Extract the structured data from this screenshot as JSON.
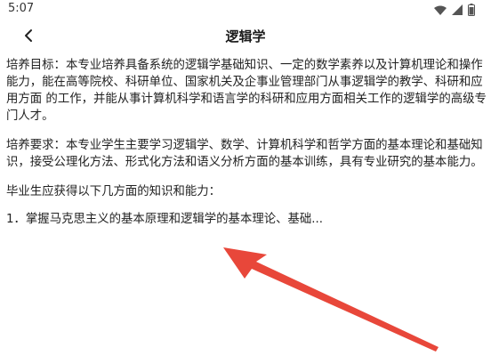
{
  "status_bar": {
    "time": "5:07",
    "icons": [
      "wifi-icon",
      "signal-icon",
      "battery-icon"
    ]
  },
  "app_bar": {
    "title": "逻辑学",
    "back_icon": "chevron-left-icon"
  },
  "content": {
    "paragraph_1": "培养目标：本专业培养具备系统的逻辑学基础知识、一定的数学素养以及计算机理论和操作 能力，能在高等院校、科研单位、国家机关及企事业管理部门从事逻辑学的教学、科研和应用方面 的工作，并能从事计算机科学和语言学的科研和应用方面相关工作的逻辑学的高级专门人才。",
    "paragraph_2": "培养要求：本专业学生主要学习逻辑学、数学、计算机科学和哲学方面的基本理论和基础知 识，接受公理化方法、形式化方法和语义分析方面的基本训练，具有专业研究的基本能力。",
    "paragraph_3": "毕业生应获得以下几方面的知识和能力：",
    "paragraph_4": "1．掌握马克思主义的基本原理和逻辑学的基本理论、基础..."
  },
  "annotation": {
    "arrow_color": "#e8473a"
  }
}
